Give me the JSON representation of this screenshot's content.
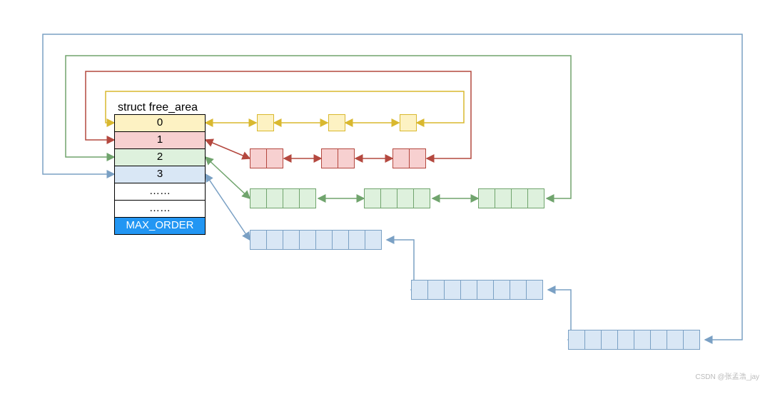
{
  "title": "struct free_area",
  "rows": {
    "r0": "0",
    "r1": "1",
    "r2": "2",
    "r3": "3",
    "dots1": "……",
    "dots2": "……",
    "max": "MAX_ORDER"
  },
  "footer": "CSDN @张孟浩_jay",
  "colors": {
    "yellow": "#d9b82f",
    "red": "#b4483f",
    "green": "#70a46d",
    "blue": "#7aa0c4"
  },
  "chart_data": {
    "type": "table",
    "description": "Buddy allocator free_area array: each order N points to a doubly-linked list of free blocks sized 2^N pages",
    "orders": [
      {
        "order": 0,
        "pages_per_block": 1,
        "blocks_shown": 3
      },
      {
        "order": 1,
        "pages_per_block": 2,
        "blocks_shown": 3
      },
      {
        "order": 2,
        "pages_per_block": 4,
        "blocks_shown": 3
      },
      {
        "order": 3,
        "pages_per_block": 8,
        "blocks_shown": 3
      },
      {
        "order": "…",
        "pages_per_block": null,
        "blocks_shown": 0
      },
      {
        "order": "…",
        "pages_per_block": null,
        "blocks_shown": 0
      },
      {
        "order": "MAX_ORDER",
        "pages_per_block": null,
        "blocks_shown": 0
      }
    ]
  }
}
